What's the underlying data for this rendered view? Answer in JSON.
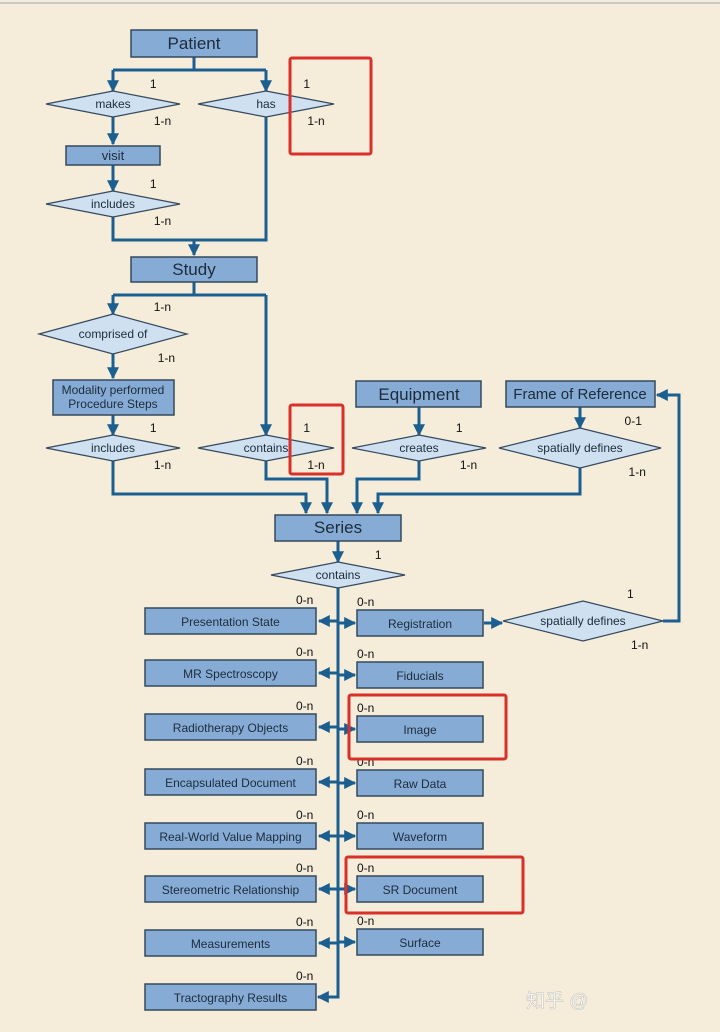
{
  "entities": {
    "patient": "Patient",
    "visit": "visit",
    "study": "Study",
    "mpps_line1": "Modality performed",
    "mpps_line2": "Procedure Steps",
    "equipment": "Equipment",
    "frame_of_reference": "Frame of Reference",
    "series": "Series"
  },
  "relationships": {
    "makes": {
      "label": "makes",
      "card_top": "1",
      "card_bottom": "1-n"
    },
    "has": {
      "label": "has",
      "card_top": "1",
      "card_bottom": "1-n"
    },
    "visit_includes": {
      "label": "includes",
      "card_top": "1",
      "card_bottom": "1-n"
    },
    "comprised_of": {
      "label": "comprised of",
      "card_top": "1-n",
      "card_bottom": "1-n"
    },
    "mpps_includes": {
      "label": "includes",
      "card_top": "1",
      "card_bottom": "1-n"
    },
    "study_contains": {
      "label": "contains",
      "card_top": "1",
      "card_bottom": "1-n"
    },
    "creates": {
      "label": "creates",
      "card_top": "1",
      "card_bottom": "1-n"
    },
    "frame_spatially_defines": {
      "label": "spatially defines",
      "card_top": "0-1",
      "card_bottom": "1-n"
    },
    "series_contains": {
      "label": "contains",
      "card_top": "1"
    },
    "registration_spatially_defines": {
      "label": "spatially defines",
      "card_top": "1",
      "card_bottom": "1-n"
    }
  },
  "series_children": {
    "left": [
      {
        "label": "Presentation State",
        "card": "0-n"
      },
      {
        "label": "MR Spectroscopy",
        "card": "0-n"
      },
      {
        "label": "Radiotherapy Objects",
        "card": "0-n"
      },
      {
        "label": "Encapsulated Document",
        "card": "0-n"
      },
      {
        "label": "Real-World Value Mapping",
        "card": "0-n"
      },
      {
        "label": "Stereometric Relationship",
        "card": "0-n"
      },
      {
        "label": "Measurements",
        "card": "0-n"
      },
      {
        "label": "Tractography Results",
        "card": "0-n"
      }
    ],
    "right": [
      {
        "label": "Registration",
        "card": "0-n"
      },
      {
        "label": "Fiducials",
        "card": "0-n"
      },
      {
        "label": "Image",
        "card": "0-n",
        "highlighted": true
      },
      {
        "label": "Raw Data",
        "card": "0-n"
      },
      {
        "label": "Waveform",
        "card": "0-n"
      },
      {
        "label": "SR Document",
        "card": "0-n",
        "highlighted": true
      },
      {
        "label": "Surface",
        "card": "0-n"
      }
    ]
  },
  "watermark": "知乎 @",
  "colors": {
    "background": "#f5ecd9",
    "entity_fill": "#86acd6",
    "relationship_fill": "#cfe0f1",
    "connector": "#1b5f91",
    "highlight": "#d9302a"
  }
}
